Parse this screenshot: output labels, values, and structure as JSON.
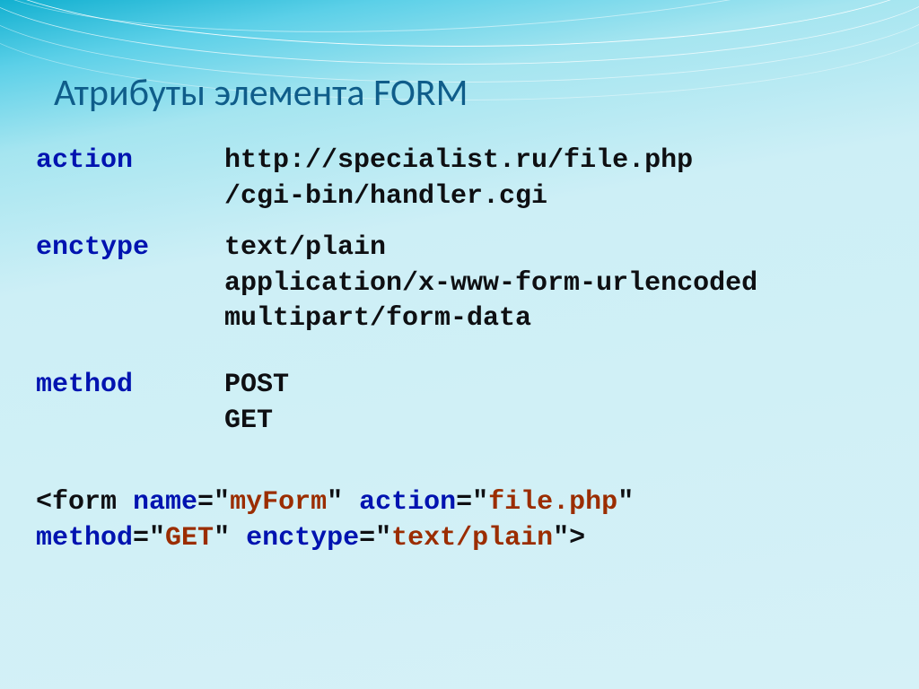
{
  "title": "Атрибуты элемента FORM",
  "attrs": {
    "action": {
      "name": "action",
      "values": "http://specialist.ru/file.php\n/cgi-bin/handler.cgi"
    },
    "enctype": {
      "name": "enctype",
      "values": "text/plain\napplication/x-www-form-urlencoded\nmultipart/form-data"
    },
    "method": {
      "name": "method",
      "values": "POST\nGET"
    }
  },
  "code": {
    "t1": "<form ",
    "t2": "name",
    "t3": "=\"",
    "t4": "myForm",
    "t5": "\" ",
    "t6": "action",
    "t7": "=\"",
    "t8": "file.php",
    "t9": "\"",
    "t10": "method",
    "t11": "=\"",
    "t12": "GET",
    "t13": "\" ",
    "t14": "enctype",
    "t15": "=\"",
    "t16": "text/plain",
    "t17": "\">"
  }
}
